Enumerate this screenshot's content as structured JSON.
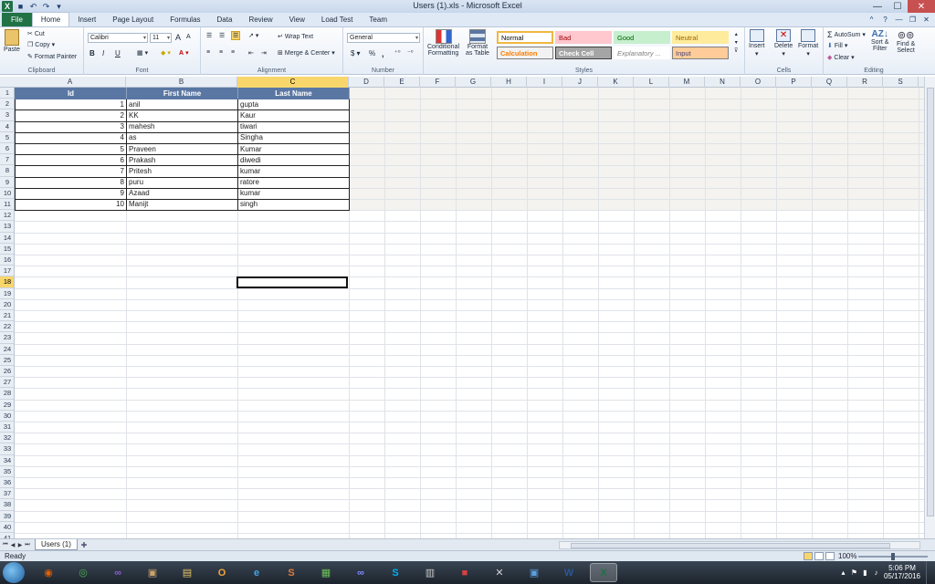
{
  "window": {
    "title": "Users (1).xls - Microsoft Excel",
    "app_icon_letter": "X",
    "qat": {
      "save_icon": "save-icon",
      "undo_glyph": "↶",
      "redo_glyph": "↷",
      "customize_glyph": "▾"
    },
    "controls": {
      "minimize": "—",
      "maximize": "☐",
      "close": "✕"
    },
    "help": {
      "minimize_ribbon": "^",
      "help": "?",
      "restore": "❐",
      "close": "✕",
      "min": "—"
    }
  },
  "ribbon_tabs": [
    "File",
    "Home",
    "Insert",
    "Page Layout",
    "Formulas",
    "Data",
    "Review",
    "View",
    "Load Test",
    "Team"
  ],
  "active_tab": "Home",
  "ribbon": {
    "clipboard": {
      "label": "Clipboard",
      "paste": "Paste",
      "cut": "Cut",
      "copy": "Copy",
      "format_painter": "Format Painter"
    },
    "font": {
      "label": "Font",
      "font_name": "Calibri",
      "font_size": "11",
      "bold": "B",
      "italic": "I",
      "underline": "U",
      "grow": "A",
      "shrink": "A"
    },
    "alignment": {
      "label": "Alignment",
      "wrap_text": "Wrap Text",
      "merge_center": "Merge & Center"
    },
    "number": {
      "label": "Number",
      "format": "General",
      "currency": "$",
      "percent": "%",
      "comma": ","
    },
    "styles": {
      "label": "Styles",
      "conditional_formatting": "Conditional",
      "conditional_formatting_2": "Formatting",
      "format_as_table": "Format",
      "format_as_table_2": "as Table",
      "cells": [
        {
          "name": "Normal",
          "bg": "#ffffff",
          "fg": "#000000",
          "border": "#f0b840"
        },
        {
          "name": "Bad",
          "bg": "#ffc7ce",
          "fg": "#9c0006",
          "border": "#ffc7ce"
        },
        {
          "name": "Good",
          "bg": "#c6efce",
          "fg": "#006100",
          "border": "#c6efce"
        },
        {
          "name": "Neutral",
          "bg": "#ffeb9c",
          "fg": "#9c6500",
          "border": "#ffeb9c"
        },
        {
          "name": "Calculation",
          "bg": "#f2f2f2",
          "fg": "#fa7d00",
          "border": "#7f7f7f"
        },
        {
          "name": "Check Cell",
          "bg": "#a5a5a5",
          "fg": "#ffffff",
          "border": "#3f3f3f"
        },
        {
          "name": "Explanatory ...",
          "bg": "#ffffff",
          "fg": "#7f7f7f",
          "border": "#ffffff"
        },
        {
          "name": "Input",
          "bg": "#ffcc99",
          "fg": "#3f3f76",
          "border": "#7f7f7f"
        }
      ]
    },
    "cells": {
      "label": "Cells",
      "insert": "Insert",
      "delete": "Delete",
      "format": "Format"
    },
    "editing": {
      "label": "Editing",
      "autosum": "AutoSum",
      "fill": "Fill",
      "clear": "Clear",
      "sort_filter": "Sort &",
      "sort_filter_2": "Filter",
      "find_select": "Find &",
      "find_select_2": "Select"
    }
  },
  "columns": [
    "A",
    "B",
    "C",
    "D",
    "E",
    "F",
    "G",
    "H",
    "I",
    "J",
    "K",
    "L",
    "M",
    "N",
    "O",
    "P",
    "Q",
    "R",
    "S"
  ],
  "selected_column": "C",
  "rows": [
    "1",
    "2",
    "3",
    "4",
    "5",
    "6",
    "7",
    "8",
    "9",
    "10",
    "11",
    "12",
    "13",
    "14",
    "15",
    "16",
    "17",
    "18",
    "19",
    "20",
    "21",
    "22",
    "23",
    "24",
    "25",
    "26",
    "27",
    "28",
    "29",
    "30",
    "31",
    "32",
    "33",
    "34",
    "35",
    "36",
    "37",
    "38",
    "39",
    "40",
    "41"
  ],
  "selected_row": "18",
  "table": {
    "headers": [
      "Id",
      "First Name",
      "Last Name"
    ],
    "rows": [
      [
        "1",
        "anil",
        "gupta"
      ],
      [
        "2",
        "KK",
        "Kaur"
      ],
      [
        "3",
        "mahesh",
        "tiwari"
      ],
      [
        "4",
        "as",
        "Singha"
      ],
      [
        "5",
        "Praveen",
        "Kumar"
      ],
      [
        "6",
        "Prakash",
        "diwedi"
      ],
      [
        "7",
        "Pritesh",
        "kumar"
      ],
      [
        "8",
        "puru",
        "ratore"
      ],
      [
        "9",
        "Azaad",
        "kumar"
      ],
      [
        "10",
        "Manijt",
        "singh"
      ]
    ]
  },
  "sheet_tabs": [
    "Users (1)"
  ],
  "status": {
    "ready": "Ready",
    "zoom": "100%"
  },
  "taskbar": {
    "apps": [
      {
        "name": "firefox",
        "glyph": "◉",
        "color": "#e66000"
      },
      {
        "name": "chrome",
        "glyph": "◎",
        "color": "#4caf50"
      },
      {
        "name": "visual-studio",
        "glyph": "∞",
        "color": "#8a5fd0"
      },
      {
        "name": "photo-viewer",
        "glyph": "▣",
        "color": "#c9a36a"
      },
      {
        "name": "file-explorer",
        "glyph": "▤",
        "color": "#e7c46a"
      },
      {
        "name": "outlook",
        "glyph": "O",
        "color": "#f0a43a"
      },
      {
        "name": "internet-explorer",
        "glyph": "e",
        "color": "#3fa7e8"
      },
      {
        "name": "sublime",
        "glyph": "S",
        "color": "#e07b39"
      },
      {
        "name": "process-monitor",
        "glyph": "▦",
        "color": "#6bbf59"
      },
      {
        "name": "infinity-app",
        "glyph": "∞",
        "color": "#7c8cff"
      },
      {
        "name": "skype",
        "glyph": "S",
        "color": "#00aff0"
      },
      {
        "name": "documents",
        "glyph": "▥",
        "color": "#c8c8c8"
      },
      {
        "name": "toolbox",
        "glyph": "■",
        "color": "#d94040"
      },
      {
        "name": "tools",
        "glyph": "✕",
        "color": "#d0d0d0"
      },
      {
        "name": "remote-desktop",
        "glyph": "▣",
        "color": "#5aa0e0"
      },
      {
        "name": "word",
        "glyph": "W",
        "color": "#2b5797"
      },
      {
        "name": "excel",
        "glyph": "X",
        "color": "#1e7145"
      }
    ],
    "clock_time": "5:06 PM",
    "clock_date": "05/17/2016"
  }
}
